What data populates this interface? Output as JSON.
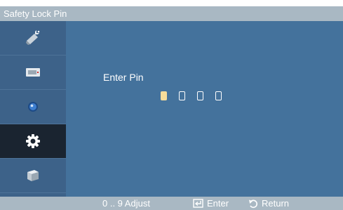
{
  "title": "Safety Lock Pin",
  "sidebar": {
    "items": [
      {
        "icon": "picture-icon",
        "active": false
      },
      {
        "icon": "input-source-icon",
        "active": false
      },
      {
        "icon": "sound-icon",
        "active": false
      },
      {
        "icon": "setup-gear-icon",
        "active": true
      },
      {
        "icon": "multi-control-icon",
        "active": false
      }
    ]
  },
  "main": {
    "prompt": "Enter Pin",
    "pin_digit_count": 4,
    "active_digit": 1
  },
  "footer": {
    "adjust": "0 .. 9 Adjust",
    "enter": "Enter",
    "return": "Return"
  },
  "colors": {
    "titlebar": "#a9b8c3",
    "sidebar": "#3d6289",
    "sidebar_active": "#1a2430",
    "main": "#44729c",
    "active_digit": "#f6dc9a"
  }
}
